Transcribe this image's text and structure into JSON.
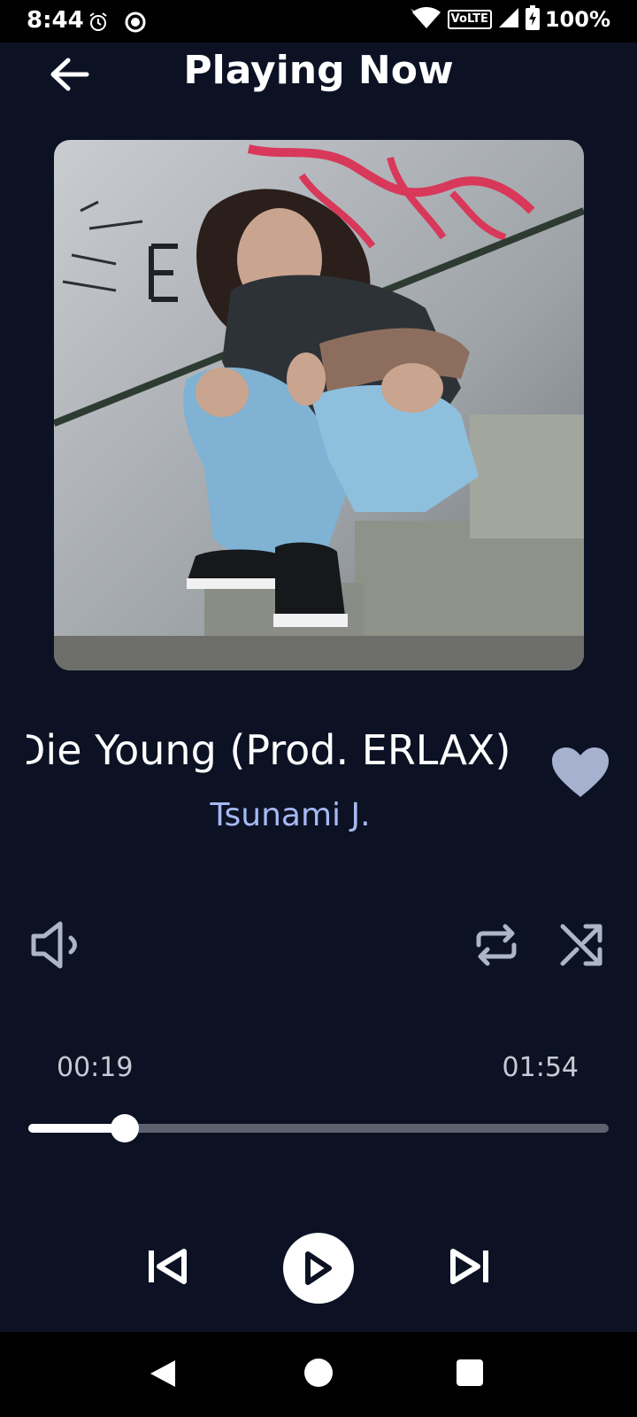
{
  "status_bar": {
    "time": "8:44",
    "icons": [
      "alarm-icon",
      "record-icon",
      "wifi-icon",
      "volte-icon",
      "signal-icon",
      "battery-icon"
    ],
    "volte_label": "VoLTE",
    "battery": "100%"
  },
  "header": {
    "title": "Playing Now",
    "back_icon": "arrow-left-icon"
  },
  "track": {
    "title": "Die Young (Prod. ERLAX)",
    "artist": "Tsunami J.",
    "favorite": true
  },
  "playback": {
    "current_time": "00:19",
    "total_time": "01:54",
    "progress": 0.166,
    "state": "paused"
  },
  "controls": [
    "volume-icon",
    "repeat-icon",
    "shuffle-icon",
    "previous-icon",
    "play-icon",
    "next-icon"
  ],
  "colors": {
    "background": "#0c1224",
    "accent": "#a6b9f3",
    "favorite": "#a6b0cf",
    "icon_muted": "#aeb5c9"
  }
}
